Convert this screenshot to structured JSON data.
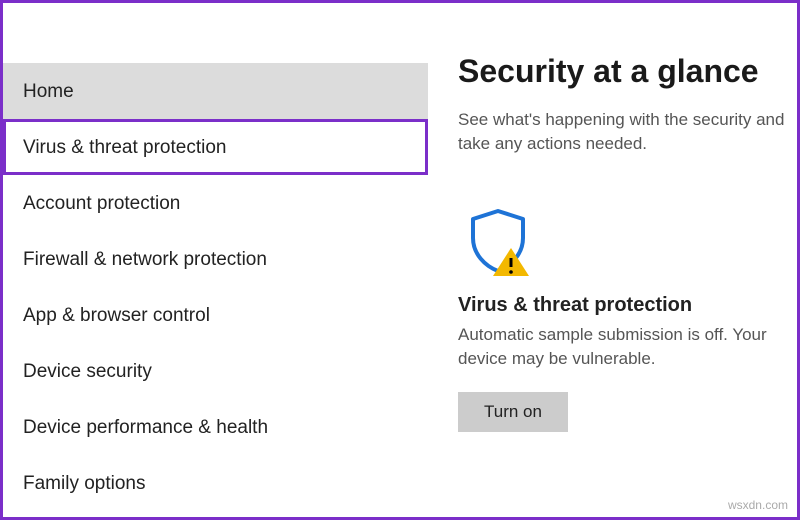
{
  "sidebar": {
    "items": [
      {
        "label": "Home",
        "state": "active"
      },
      {
        "label": "Virus & threat protection",
        "state": "highlighted"
      },
      {
        "label": "Account protection",
        "state": ""
      },
      {
        "label": "Firewall & network protection",
        "state": ""
      },
      {
        "label": "App & browser control",
        "state": ""
      },
      {
        "label": "Device security",
        "state": ""
      },
      {
        "label": "Device performance & health",
        "state": ""
      },
      {
        "label": "Family options",
        "state": ""
      }
    ]
  },
  "main": {
    "title": "Security at a glance",
    "subtitle": "See what's happening with the security and take any actions needed."
  },
  "card": {
    "icon": "shield-warning-icon",
    "title": "Virus & threat protection",
    "description": "Automatic sample submission is off. Your device may be vulnerable.",
    "button": "Turn on"
  },
  "colors": {
    "accent": "#7b2fc9",
    "shield": "#1e73d6",
    "warning": "#f3b800"
  },
  "watermark": "wsxdn.com"
}
